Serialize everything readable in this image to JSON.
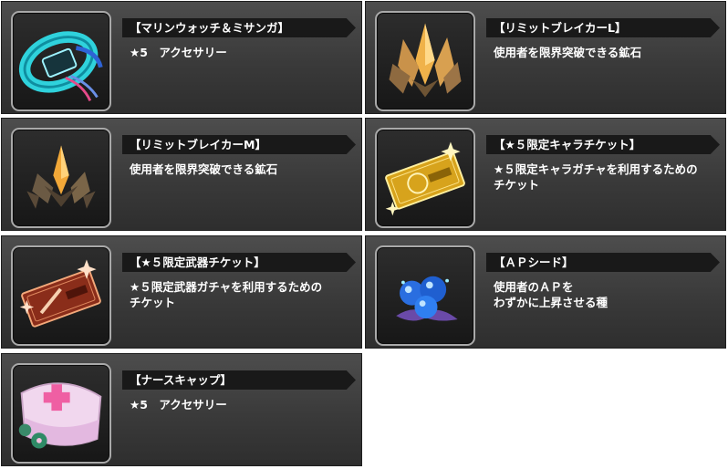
{
  "items": [
    {
      "icon": "watch-and-misanga-icon",
      "title": "【マリンウォッチ＆ミサンガ】",
      "desc": "★5　アクセサリー"
    },
    {
      "icon": "limit-breaker-l-icon",
      "title": "【リミットブレイカーL】",
      "desc": "使用者を限界突破できる鉱石"
    },
    {
      "icon": "limit-breaker-m-icon",
      "title": "【リミットブレイカーM】",
      "desc": "使用者を限界突破できる鉱石"
    },
    {
      "icon": "gold-ticket-icon",
      "title": "【★５限定キャラチケット】",
      "desc": "★５限定キャラガチャを利用するための\nチケット"
    },
    {
      "icon": "weapon-ticket-icon",
      "title": "【★５限定武器チケット】",
      "desc": "★５限定武器ガチャを利用するための\nチケット"
    },
    {
      "icon": "ap-seed-icon",
      "title": "【ＡＰシード】",
      "desc": "使用者のＡＰを\nわずかに上昇させる種"
    },
    {
      "icon": "nurse-cap-icon",
      "title": "【ナースキャップ】",
      "desc": "★5　アクセサリー"
    }
  ]
}
